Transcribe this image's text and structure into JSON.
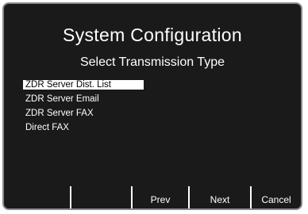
{
  "screen": {
    "title": "System Configuration",
    "subtitle": "Select Transmission Type"
  },
  "options": [
    {
      "label": "ZDR Server Dist. List",
      "selected": true
    },
    {
      "label": "ZDR Server Email",
      "selected": false
    },
    {
      "label": "ZDR Server FAX",
      "selected": false
    },
    {
      "label": "Direct FAX",
      "selected": false
    }
  ],
  "softkeys": {
    "key1": "",
    "key2": "",
    "prev": "Prev",
    "next": "Next",
    "cancel": "Cancel"
  },
  "colors": {
    "screen_background": "#1a1a1a",
    "text": "#ffffff",
    "highlight_background": "#ffffff",
    "highlight_text": "#000000"
  }
}
